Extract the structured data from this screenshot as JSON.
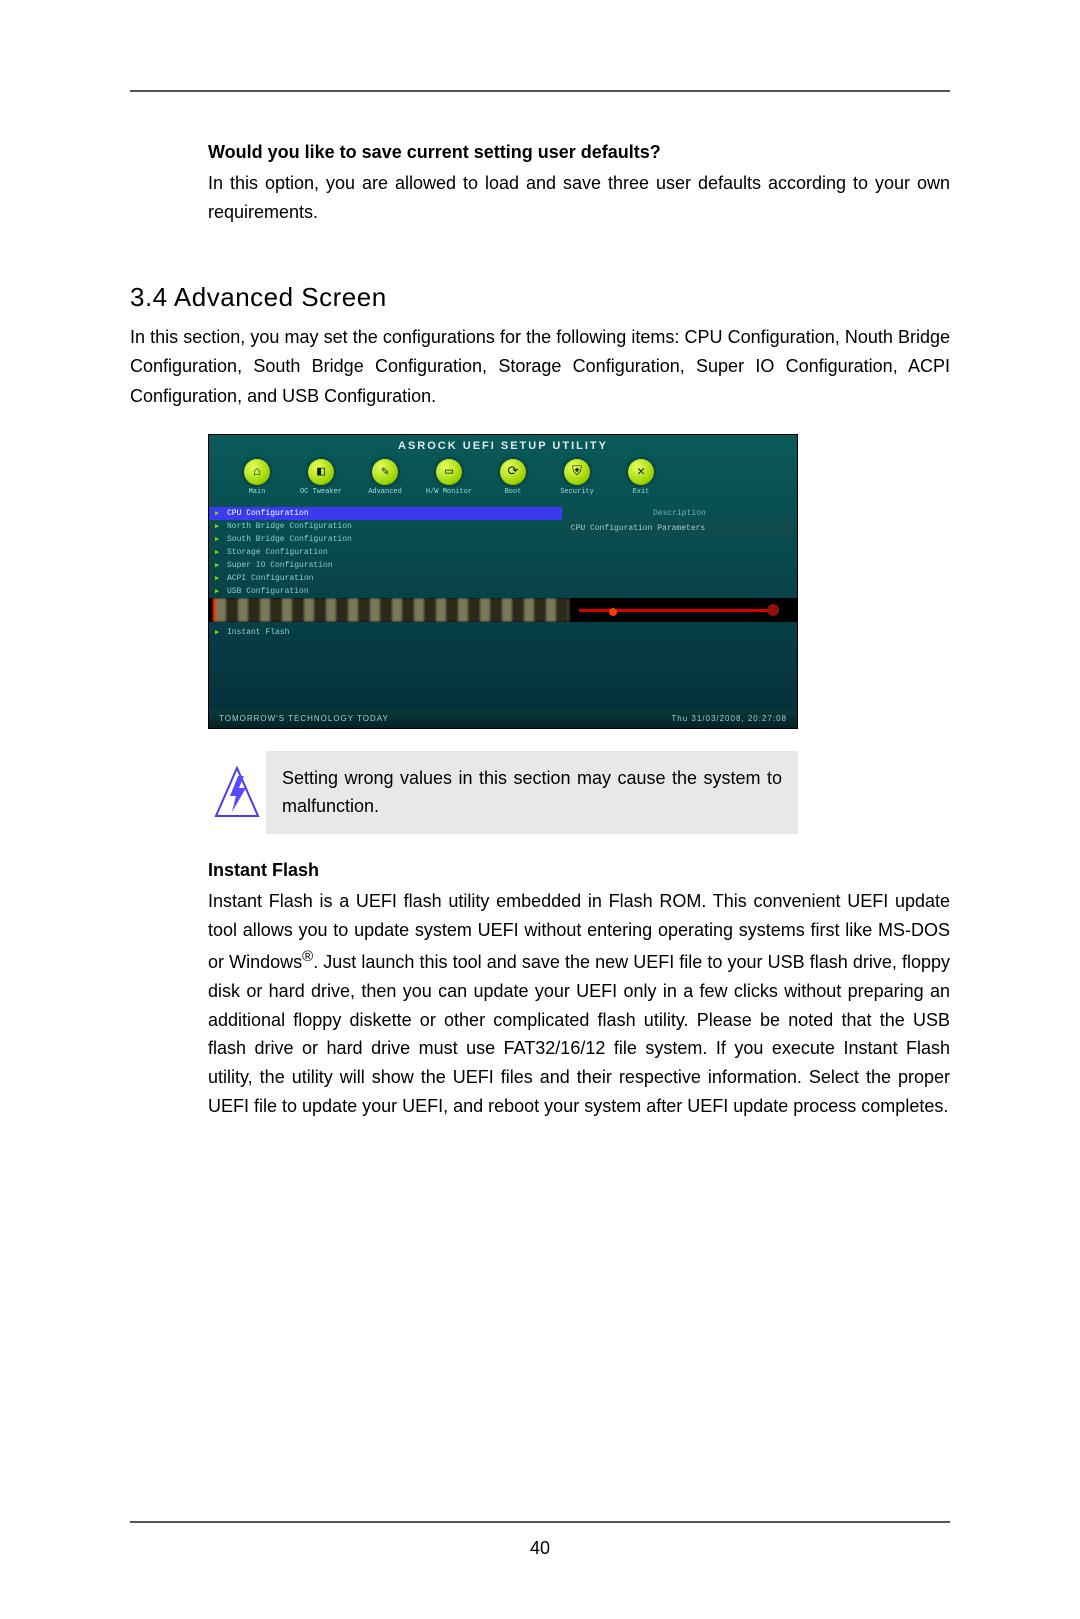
{
  "page_number": "40",
  "save_defaults": {
    "heading": "Would you like to save current setting user defaults?",
    "body": "In this option, you are allowed to load and save three user defaults according to your own requirements."
  },
  "advanced": {
    "title": "3.4  Advanced Screen",
    "intro": "In this section, you may set the configurations for the following items: CPU Configuration, Nouth Bridge Configuration, South Bridge Configuration, Storage Configuration, Super IO Configuration, ACPI Configuration, and USB Configuration."
  },
  "bios": {
    "title": "ASROCK UEFI SETUP UTILITY",
    "tabs": [
      {
        "label": "Main",
        "glyph": "⌂"
      },
      {
        "label": "OC Tweaker",
        "glyph": "◧"
      },
      {
        "label": "Advanced",
        "glyph": "✎"
      },
      {
        "label": "H/W Monitor",
        "glyph": "▭"
      },
      {
        "label": "Boot",
        "glyph": "⟳"
      },
      {
        "label": "Security",
        "glyph": "⛨"
      },
      {
        "label": "Exit",
        "glyph": "✕"
      }
    ],
    "menu_items": [
      "CPU Configuration",
      "North Bridge Configuration",
      "South Bridge Configuration",
      "Storage Configuration",
      "Super IO Configuration",
      "ACPI Configuration",
      "USB Configuration"
    ],
    "lower_item": "Instant Flash",
    "desc_header": "Description",
    "desc_text": "CPU Configuration Parameters",
    "footer_left": "TOMORROW'S TECHNOLOGY TODAY",
    "footer_right": "Thu 31/03/2008, 20:27:08"
  },
  "warning": {
    "text": "Setting wrong values in this section may cause the system to malfunction."
  },
  "instant_flash": {
    "heading": "Instant Flash",
    "body_before": "Instant Flash is a UEFI flash utility embedded in Flash ROM. This convenient UEFI update tool allows you to update system UEFI without entering operating systems first like MS-DOS or Windows",
    "body_after": ". Just launch this tool and save the new UEFI file to your USB flash drive, floppy disk or hard drive, then you can update your UEFI only in a few clicks without preparing an additional floppy diskette or other complicated flash utility. Please be noted that the USB flash drive or hard drive must use FAT32/16/12 file system. If you execute Instant Flash utility, the utility will show the UEFI files and their respective information. Select the proper UEFI file to update your UEFI, and reboot your system after UEFI update process completes."
  }
}
